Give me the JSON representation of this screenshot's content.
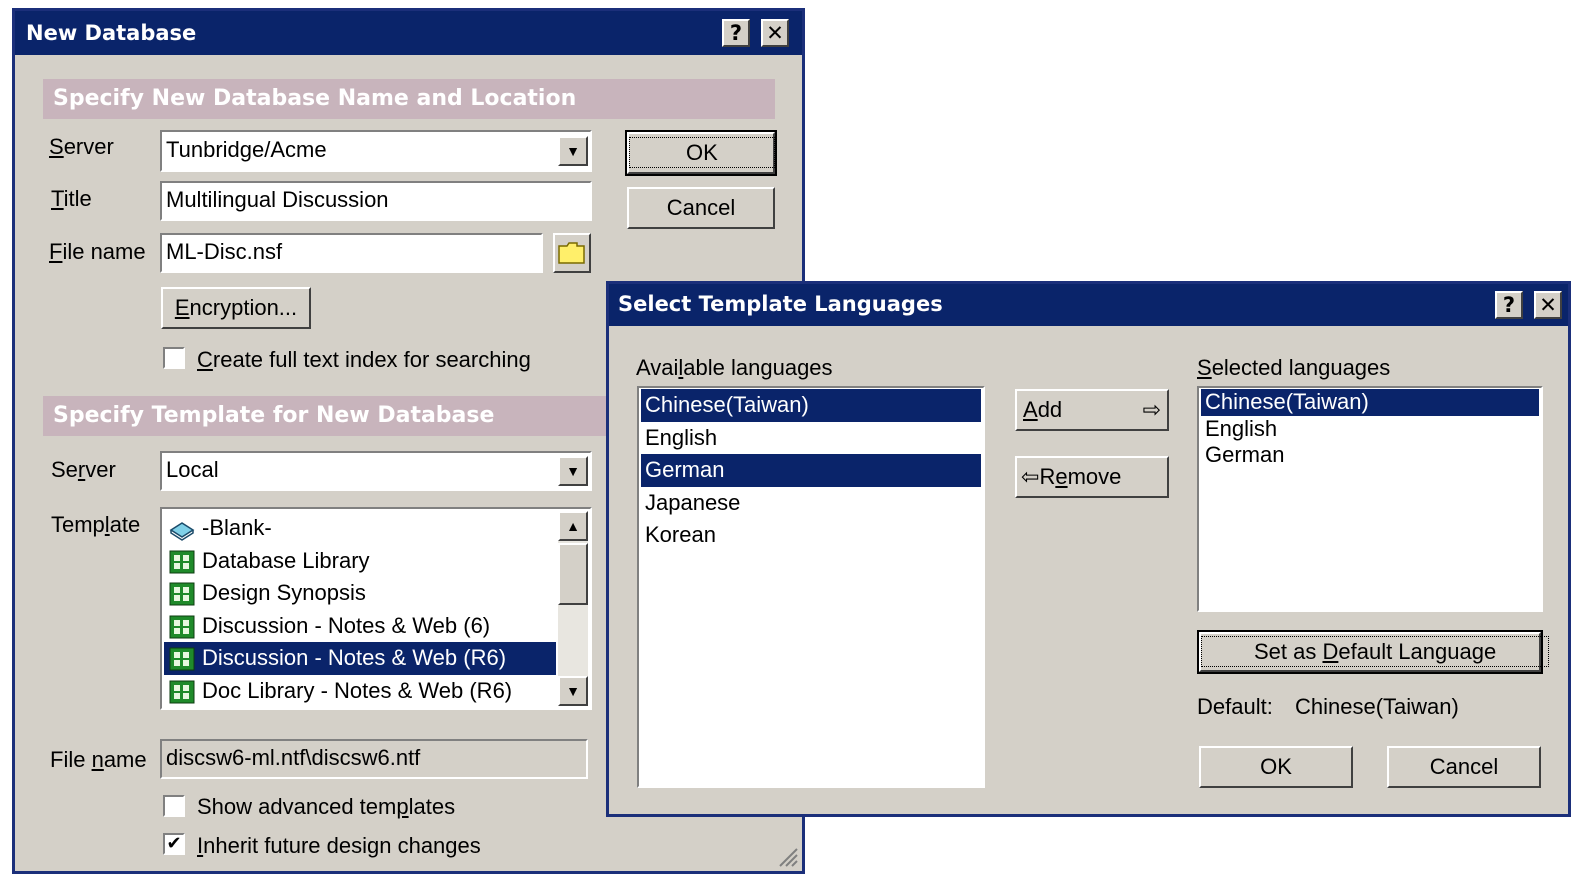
{
  "new_db": {
    "title": "New Database",
    "help_glyph": "?",
    "close_glyph": "✕",
    "section1": "Specify New Database Name and Location",
    "server_label": "Server",
    "server_value": "Tunbridge/Acme",
    "title_label": "Title",
    "title_value": "Multilingual Discussion",
    "filename_label": "File name",
    "filename_value": "ML-Disc.nsf",
    "encryption_button": "Encryption...",
    "fulltext_label": "Create full text index for searching",
    "fulltext_checked": false,
    "ok": "OK",
    "cancel": "Cancel",
    "section2": "Specify Template for New Database",
    "tserver_label": "Server",
    "tserver_value": "Local",
    "template_label": "Template",
    "templates": [
      {
        "name": "-Blank-",
        "icon": "book-icon"
      },
      {
        "name": "Database Library",
        "icon": "template-icon"
      },
      {
        "name": "Design Synopsis",
        "icon": "template-icon"
      },
      {
        "name": "Discussion - Notes & Web (6)",
        "icon": "template-icon"
      },
      {
        "name": "Discussion - Notes & Web (R6)",
        "icon": "template-icon"
      },
      {
        "name": "Doc Library - Notes & Web (R6)",
        "icon": "template-icon"
      }
    ],
    "selected_template": "Discussion - Notes & Web (R6)",
    "tfilename_label": "File name",
    "tfilename_value": "discsw6-ml.ntf\\discsw6.ntf",
    "advanced_label": "Show advanced templates",
    "advanced_checked": false,
    "inherit_label": "Inherit future design changes",
    "inherit_checked": true,
    "check_glyph": "✔"
  },
  "lang_dialog": {
    "title": "Select Template Languages",
    "help_glyph": "?",
    "close_glyph": "✕",
    "available_label": "Available languages",
    "available": [
      "Chinese(Taiwan)",
      "English",
      "German",
      "Japanese",
      "Korean"
    ],
    "available_selected": [
      "Chinese(Taiwan)",
      "German"
    ],
    "add_button": "Add",
    "add_arrow": "⇨",
    "remove_button": "Remove",
    "remove_arrow": "⇦",
    "selected_label": "Selected languages",
    "selected": [
      "Chinese(Taiwan)",
      "English",
      "German"
    ],
    "selected_highlight": "Chinese(Taiwan)",
    "set_default_button": "Set as Default Language",
    "default_label": "Default:",
    "default_value": "Chinese(Taiwan)",
    "ok": "OK",
    "cancel": "Cancel"
  },
  "colors": {
    "titlebar": "#0a246a",
    "section_band": "#c8b4bc",
    "face": "#d4d0c8",
    "selection": "#0a246a"
  }
}
